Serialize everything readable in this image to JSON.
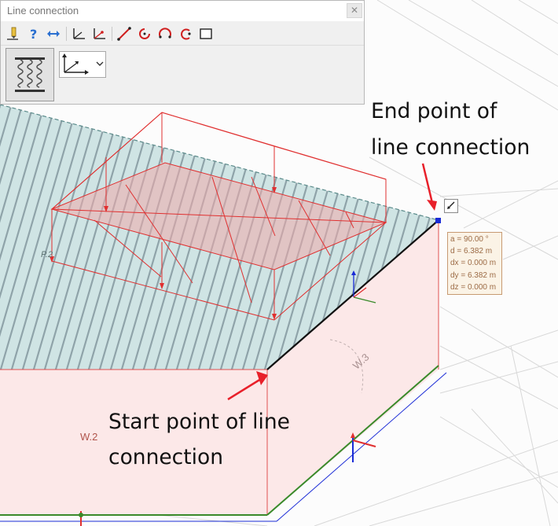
{
  "window": {
    "title": "Line connection",
    "close_symbol": "✕",
    "toolbar_icons": [
      "edit-pencil-icon",
      "help-icon",
      "swap-arrows-icon",
      "axis-system-icon",
      "axis-system-red-icon",
      "line-icon",
      "arc-center-icon",
      "arc-icon",
      "arc-3point-icon",
      "rectangle-icon"
    ],
    "main_button_icon": "spring-line-support-icon",
    "coord_selector_icon": "axis-system-icon"
  },
  "measure": {
    "rows": [
      "a  = 90.00 °",
      "d  = 6.382 m",
      "dx = 0.000 m",
      "dy = 6.382 m",
      "dz = 0.000 m"
    ]
  },
  "annotations": {
    "end_line1": "End point of",
    "end_line2": "line connection",
    "start_line1": "Start point of line",
    "start_line2": "connection"
  },
  "labels": {
    "wall2": "W.2",
    "wall3": "W.3",
    "plate": "P.2"
  },
  "colors": {
    "roof_fill": "#cfe4e4",
    "roof_hatch": "#8fa3a9",
    "wall_fill": "#fce8e8",
    "load_red": "#e03030",
    "arrow_red": "#e8202a",
    "edge_green": "#3a8a2a",
    "axis_blue": "#1a2bd6"
  }
}
